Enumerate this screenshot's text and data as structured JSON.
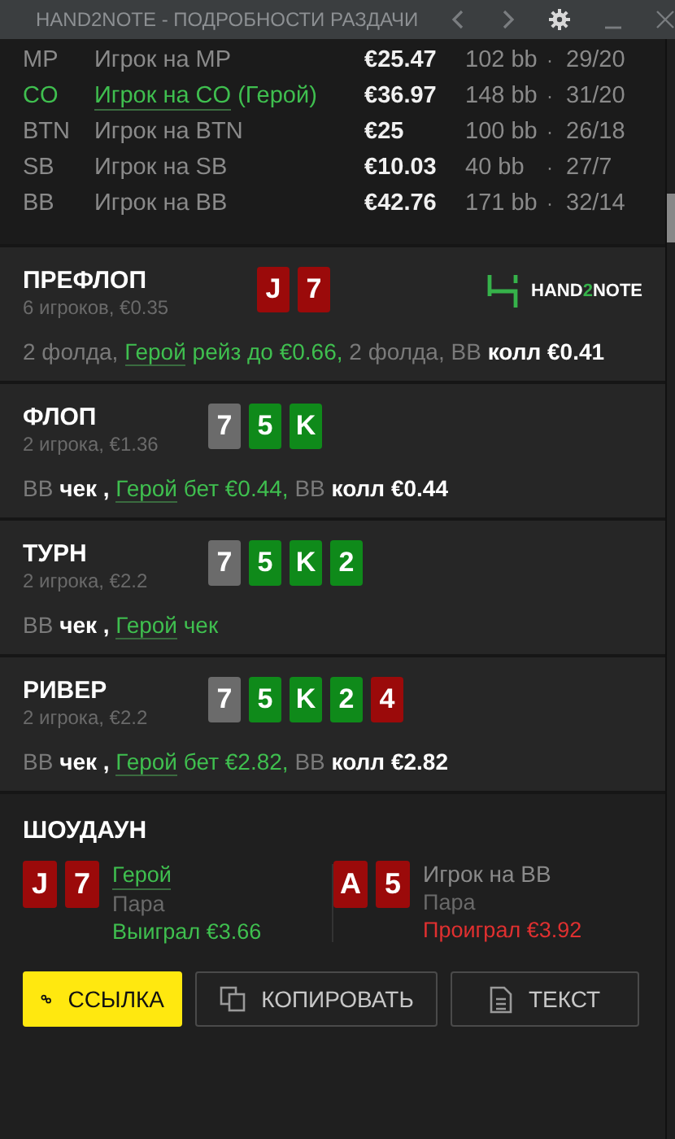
{
  "window": {
    "title": "HAND2NOTE - ПОДРОБНОСТИ РАЗДАЧИ"
  },
  "players": [
    {
      "position": "MP",
      "name": "Игрок на MP",
      "hero": false,
      "stack": "€25.47",
      "bb": "102 bb",
      "dot": "·",
      "ratio": "29/20"
    },
    {
      "position": "CO",
      "name": "Игрок на CO",
      "hero": true,
      "hero_tag": "(Герой)",
      "stack": "€36.97",
      "bb": "148 bb",
      "dot": "·",
      "ratio": "31/20"
    },
    {
      "position": "BTN",
      "name": "Игрок на BTN",
      "hero": false,
      "stack": "€25",
      "bb": "100 bb",
      "dot": "·",
      "ratio": "26/18"
    },
    {
      "position": "SB",
      "name": "Игрок на SB",
      "hero": false,
      "stack": "€10.03",
      "bb": "40 bb",
      "dot": "·",
      "ratio": "27/7"
    },
    {
      "position": "BB",
      "name": "Игрок на BB",
      "hero": false,
      "stack": "€42.76",
      "bb": "171 bb",
      "dot": "·",
      "ratio": "32/14"
    }
  ],
  "streets": [
    {
      "title": "ПРЕФЛОП",
      "info": "6 игроков, €0.35",
      "logo": {
        "parts": [
          {
            "text": "HAND",
            "accent": false
          },
          {
            "text": "2",
            "accent": true
          },
          {
            "text": "NOTE",
            "accent": false
          }
        ]
      },
      "cards": [
        {
          "rank": "J",
          "color": "#9b0a0a"
        },
        {
          "rank": "7",
          "color": "#9b0a0a"
        }
      ],
      "actions": [
        {
          "kind": "muted",
          "text": "2 фолда, "
        },
        {
          "kind": "hero",
          "text": "Герой"
        },
        {
          "kind": "green",
          "text": " рейз до €0.66, "
        },
        {
          "kind": "muted",
          "text": "2 фолда, BB "
        },
        {
          "kind": "strong",
          "text": "колл €0.41"
        }
      ]
    },
    {
      "title": "ФЛОП",
      "info": "2 игрока, €1.36",
      "cards": [
        {
          "rank": "7",
          "color": "#6b6b6b"
        },
        {
          "rank": "5",
          "color": "#0f8a1a"
        },
        {
          "rank": "K",
          "color": "#0f8a1a"
        }
      ],
      "actions": [
        {
          "kind": "muted",
          "text": "BB "
        },
        {
          "kind": "strong",
          "text": "чек , "
        },
        {
          "kind": "hero",
          "text": "Герой"
        },
        {
          "kind": "green",
          "text": " бет €0.44, "
        },
        {
          "kind": "muted",
          "text": "BB "
        },
        {
          "kind": "strong",
          "text": "колл €0.44"
        }
      ]
    },
    {
      "title": "ТУРН",
      "info": "2 игрока, €2.2",
      "cards": [
        {
          "rank": "7",
          "color": "#6b6b6b"
        },
        {
          "rank": "5",
          "color": "#0f8a1a"
        },
        {
          "rank": "K",
          "color": "#0f8a1a"
        },
        {
          "rank": "2",
          "color": "#0f8a1a"
        }
      ],
      "actions": [
        {
          "kind": "muted",
          "text": "BB "
        },
        {
          "kind": "strong",
          "text": "чек , "
        },
        {
          "kind": "hero",
          "text": "Герой"
        },
        {
          "kind": "green",
          "text": " чек"
        }
      ]
    },
    {
      "title": "РИВЕР",
      "info": "2 игрока, €2.2",
      "cards": [
        {
          "rank": "7",
          "color": "#6b6b6b"
        },
        {
          "rank": "5",
          "color": "#0f8a1a"
        },
        {
          "rank": "K",
          "color": "#0f8a1a"
        },
        {
          "rank": "2",
          "color": "#0f8a1a"
        },
        {
          "rank": "4",
          "color": "#9b0a0a"
        }
      ],
      "actions": [
        {
          "kind": "muted",
          "text": "BB "
        },
        {
          "kind": "strong",
          "text": "чек , "
        },
        {
          "kind": "hero",
          "text": "Герой"
        },
        {
          "kind": "green",
          "text": " бет €2.82, "
        },
        {
          "kind": "muted",
          "text": "BB "
        },
        {
          "kind": "strong",
          "text": "колл €2.82"
        }
      ]
    }
  ],
  "showdown": {
    "title": "ШОУДАУН",
    "players": [
      {
        "name": "Герой",
        "hero": true,
        "hand": "Пара",
        "result": "Выиграл €3.66",
        "won": true,
        "cards": [
          {
            "rank": "J",
            "color": "#9b0a0a"
          },
          {
            "rank": "7",
            "color": "#9b0a0a"
          }
        ]
      },
      {
        "name": "Игрок на BB",
        "hero": false,
        "hand": "Пара",
        "result": "Проиграл €3.92",
        "won": false,
        "cards": [
          {
            "rank": "A",
            "color": "#9b0a0a"
          },
          {
            "rank": "5",
            "color": "#9b0a0a"
          }
        ]
      }
    ]
  },
  "buttons": [
    {
      "label": "ССЫЛКА",
      "kind": "link"
    },
    {
      "label": "КОПИРОВАТЬ",
      "kind": "copy"
    },
    {
      "label": "ТЕКСТ",
      "kind": "text"
    }
  ]
}
